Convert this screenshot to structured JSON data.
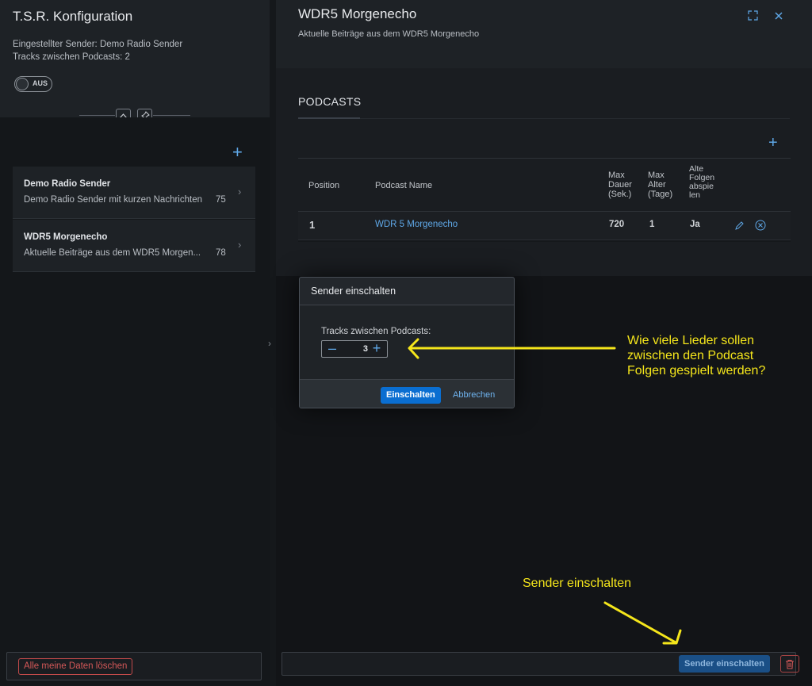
{
  "left": {
    "title": "T.S.R. Konfiguration",
    "station_info": "Eingestellter Sender: Demo Radio Sender",
    "tracks_info": "Tracks zwischen Podcasts: 2",
    "toggle_label": "AUS",
    "items": [
      {
        "title": "Demo Radio Sender",
        "desc": "Demo Radio Sender mit kurzen Nachrichten",
        "count": "75"
      },
      {
        "title": "WDR5 Morgenecho",
        "desc": "Aktuelle Beiträge aus dem WDR5 Morgen...",
        "count": "78"
      }
    ],
    "delete_all_label": "Alle meine Daten löschen"
  },
  "detail": {
    "title": "WDR5 Morgenecho",
    "subtitle": "Aktuelle Beiträge aus dem WDR5 Morgenecho",
    "tab": "PODCASTS",
    "columns": {
      "position": "Position",
      "name": "Podcast Name",
      "max_duration": [
        "Max",
        "Dauer",
        "(Sek.)"
      ],
      "max_age": [
        "Max",
        "Alter",
        "(Tage)"
      ],
      "old_episodes": [
        "Alte",
        "Folgen",
        "abspie",
        "len"
      ]
    },
    "rows": [
      {
        "position": "1",
        "name": "WDR 5 Morgenecho",
        "max_duration": "720",
        "max_age": "1",
        "old_episodes": "Ja"
      }
    ],
    "activate_label": "Sender einschalten"
  },
  "dialog": {
    "title": "Sender einschalten",
    "field_label": "Tracks zwischen Podcasts:",
    "value": "3",
    "confirm_label": "Einschalten",
    "cancel_label": "Abbrechen"
  },
  "annotations": {
    "stepper_note": [
      "Wie viele Lieder sollen",
      "zwischen den Podcast",
      "Folgen gespielt werden?"
    ],
    "activate_note": "Sender einschalten",
    "color": "#f5e61b"
  },
  "colors": {
    "accent": "#0a6ed1",
    "link": "#5fa8e8",
    "danger": "#d45858"
  }
}
